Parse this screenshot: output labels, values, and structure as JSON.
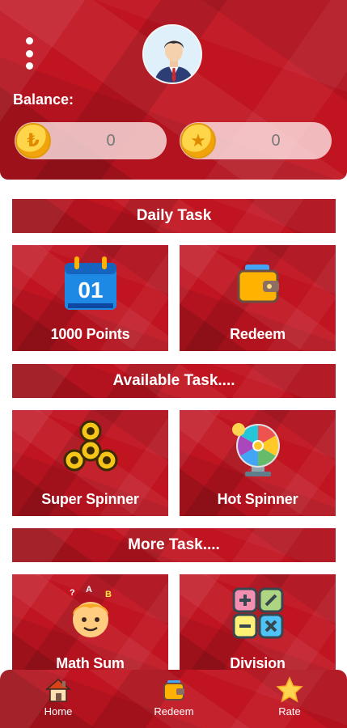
{
  "header": {
    "balance_label": "Balance:",
    "coin_balance": "0",
    "star_balance": "0",
    "coin_icon": "rupee-coin-icon",
    "star_icon": "star-coin-icon"
  },
  "sections": {
    "daily": "Daily Task",
    "available": "Available Task....",
    "more": "More Task...."
  },
  "cards": {
    "points": "1000 Points",
    "redeem": "Redeem",
    "super_spinner": "Super Spinner",
    "hot_spinner": "Hot Spinner",
    "math_sum": "Math Sum",
    "division": "Division"
  },
  "calendar_number": "01",
  "nav": {
    "home": "Home",
    "redeem": "Redeem",
    "rate": "Rate"
  },
  "colors": {
    "primary_red": "#c01420",
    "coin_gold": "#ffd54a",
    "white": "#ffffff"
  }
}
